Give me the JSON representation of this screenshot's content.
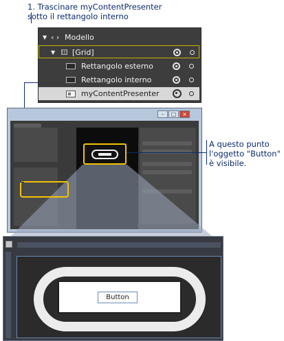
{
  "callouts": {
    "step1_line1": "1. Trascinare myContentPresenter",
    "step1_line2": "sotto il rettangolo interno",
    "result_line1": "A questo punto",
    "result_line2": "l'oggetto \"Button\"",
    "result_line3": "è visibile."
  },
  "tree": {
    "root": {
      "label": "Modello",
      "icon": "angle-brackets-icon"
    },
    "grid": {
      "label": "[Grid]",
      "icon": "grid-icon"
    },
    "items": [
      {
        "label": "Rettangolo esterno",
        "icon": "rectangle-icon"
      },
      {
        "label": "Rettangolo interno",
        "icon": "rectangle-icon"
      },
      {
        "label": "myContentPresenter",
        "icon": "content-presenter-icon"
      }
    ]
  },
  "preview": {
    "button_label": "Button"
  },
  "colors": {
    "highlight": "#f5c400",
    "callout_text": "#0a2a6e",
    "panel_bg": "#3d3d3d"
  }
}
